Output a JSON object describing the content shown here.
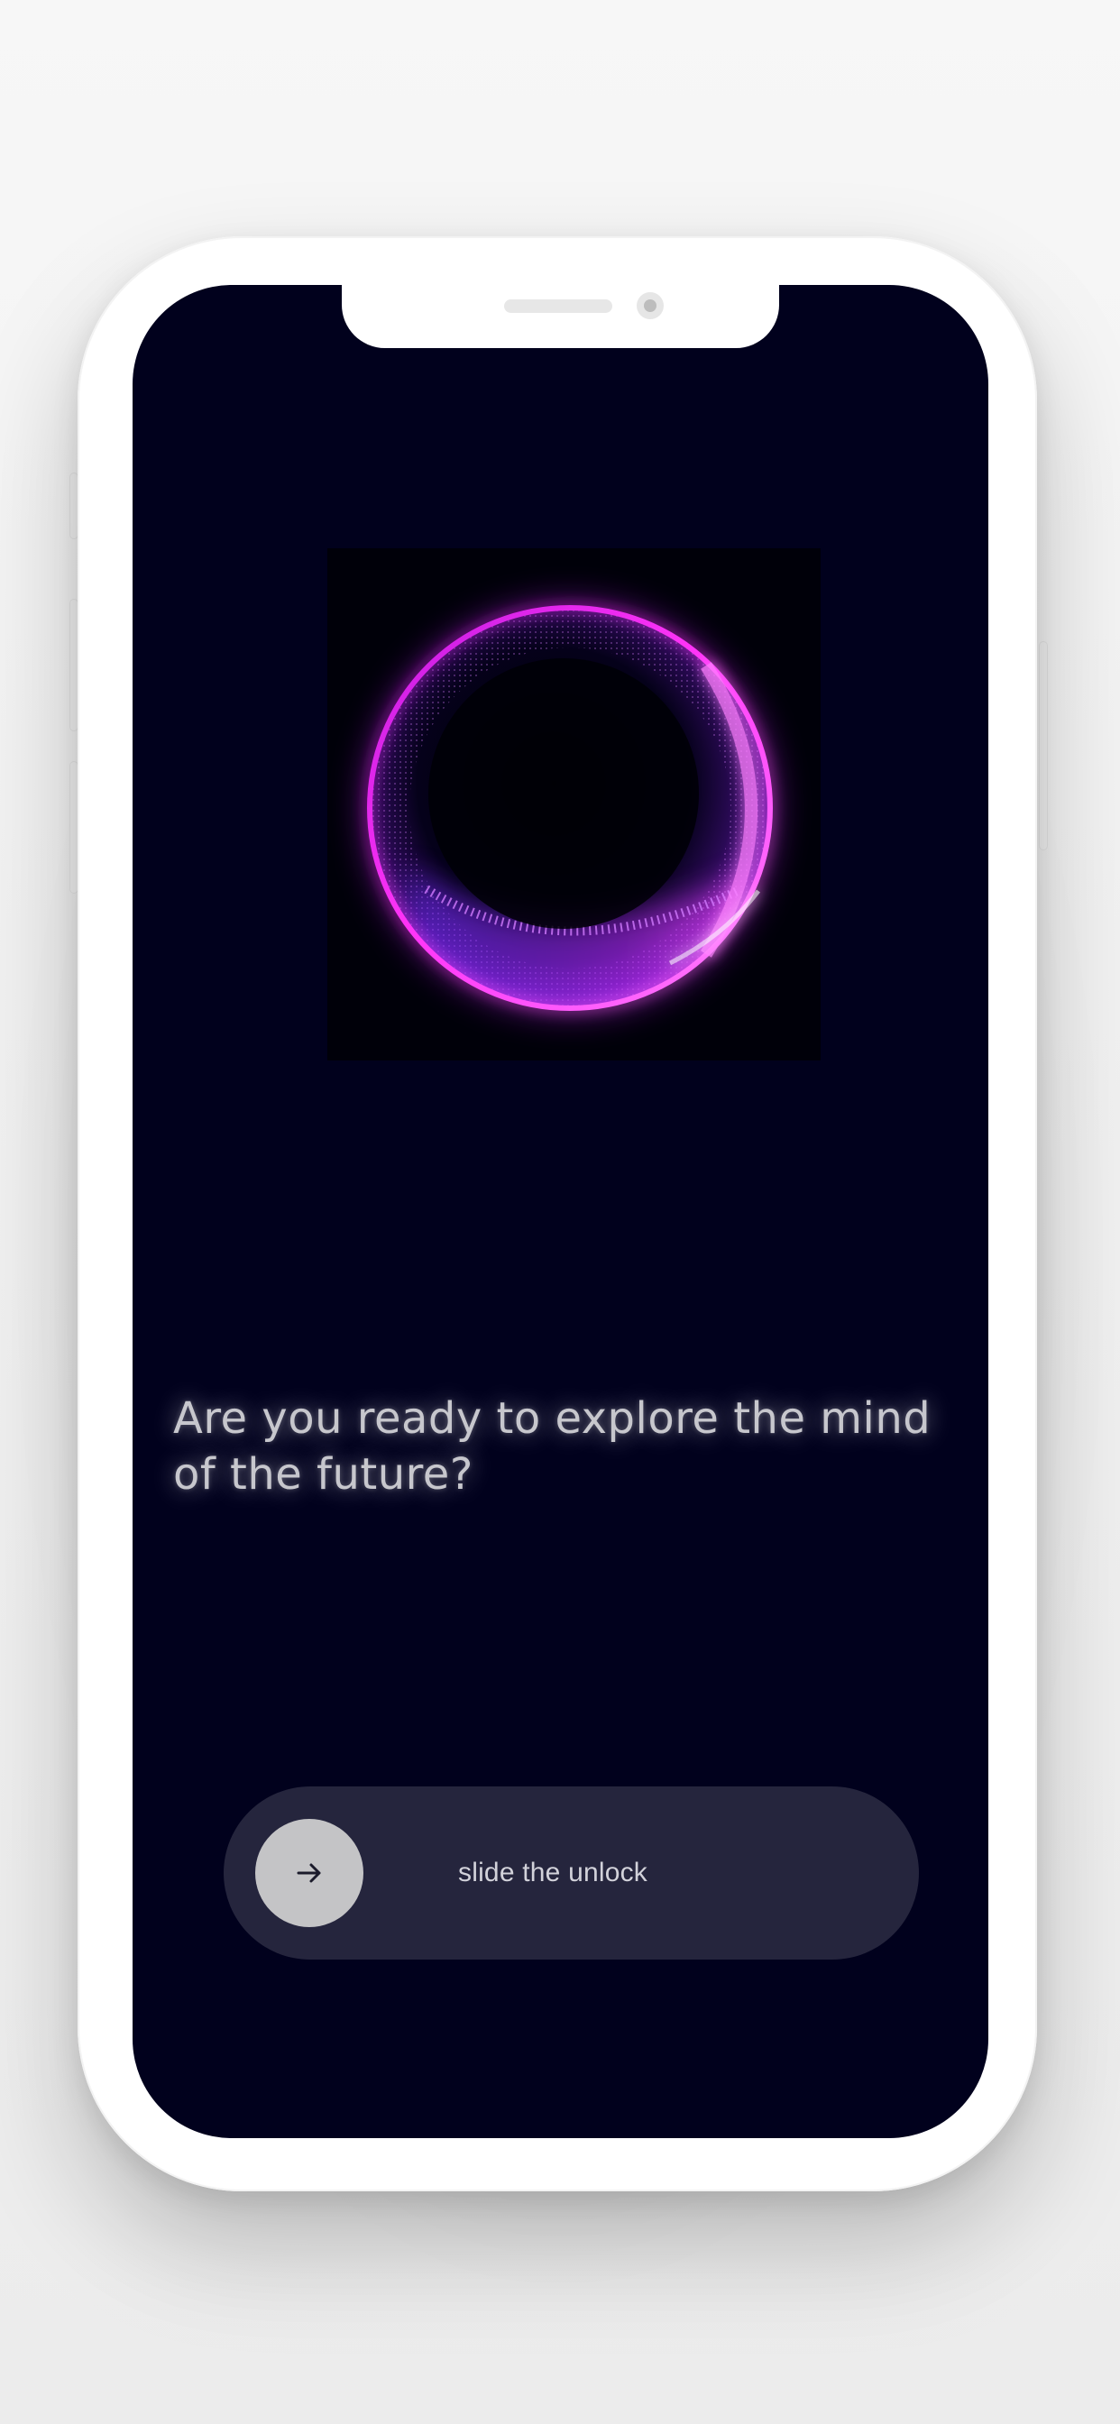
{
  "onboarding": {
    "headline": "Are you ready to explore the mind of the future?",
    "slider": {
      "label": "slide the unlock",
      "knob_icon": "arrow-right-icon"
    },
    "hero_image": "glowing-particle-sphere"
  },
  "colors": {
    "screen_background": "#01011d",
    "slider_track": "#25253d",
    "slider_knob": "#c4c4c6",
    "sphere_magenta": "#ff2bf5",
    "sphere_violet": "#7a2cff",
    "headline_text": "#c7c7cd"
  }
}
